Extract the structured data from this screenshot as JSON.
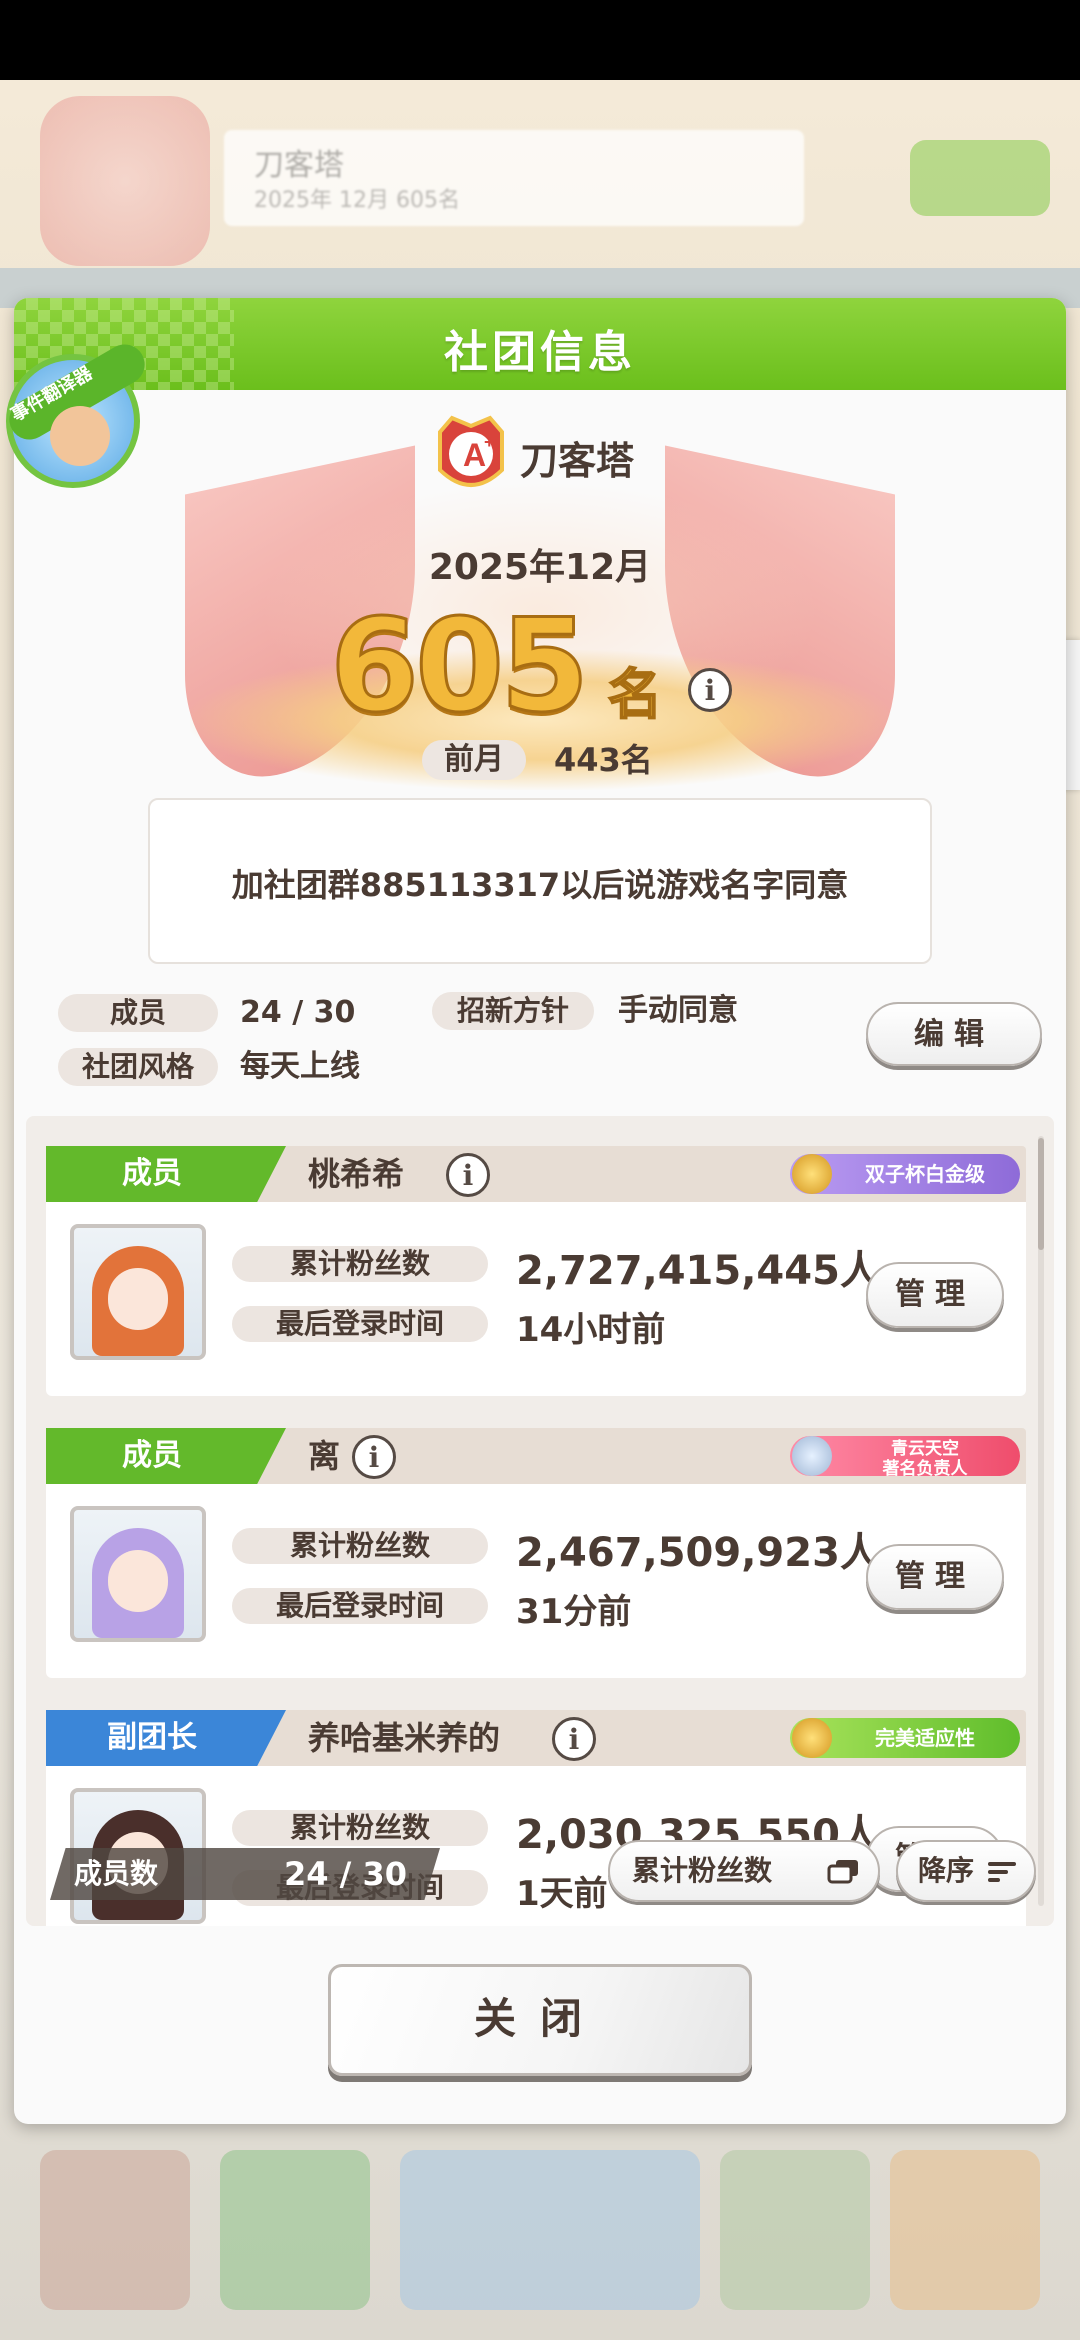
{
  "background": {
    "club_name": "刀客塔",
    "club_sub": "2025年 12月 605名"
  },
  "modal": {
    "title": "社团信息",
    "translator_badge": "事件翻译器"
  },
  "club": {
    "name": "刀客塔",
    "month": "2025年12月",
    "rank_number": "605",
    "rank_suffix": "名",
    "prev_label": "前月",
    "prev_value": "443名",
    "description": "加社团群885113317以后说游戏名字同意",
    "fields": {
      "members_label": "成员",
      "members_value": "24 / 30",
      "recruit_label": "招新方针",
      "recruit_value": "手动同意",
      "style_label": "社团风格",
      "style_value": "每天上线"
    },
    "edit_label": "编辑"
  },
  "members": [
    {
      "role": "成员",
      "name": "桃希希",
      "badge": "双子杯白金级",
      "fans_label": "累计粉丝数",
      "fans_value": "2,727,415,445人",
      "login_label": "最后登录时间",
      "login_value": "14小时前",
      "manage_label": "管理"
    },
    {
      "role": "成员",
      "name": "离",
      "badge": "青云天空\n著名负责人",
      "fans_label": "累计粉丝数",
      "fans_value": "2,467,509,923人",
      "login_label": "最后登录时间",
      "login_value": "31分前",
      "manage_label": "管理"
    },
    {
      "role": "副团长",
      "name": "养哈基米养的",
      "badge": "完美适应性",
      "fans_label": "累计粉丝数",
      "fans_value": "2,030,325,550人",
      "login_label": "最后登录时间",
      "login_value": "1天前",
      "manage_label": "管理"
    }
  ],
  "footer": {
    "count_label": "成员数",
    "count_value": "24 / 30",
    "sort_key": "累计粉丝数",
    "sort_order": "降序"
  },
  "close_label": "关闭",
  "icons": {
    "info": "info-icon",
    "sort_key": "switch-icon",
    "sort_order": "sort-lines-icon",
    "side_tab": "chevron-left-icon"
  },
  "colors": {
    "header_green": "#6bbf1c",
    "role_member": "#63b92b",
    "role_vice": "#3b86d8",
    "rank_gold": "#f2b83a"
  }
}
